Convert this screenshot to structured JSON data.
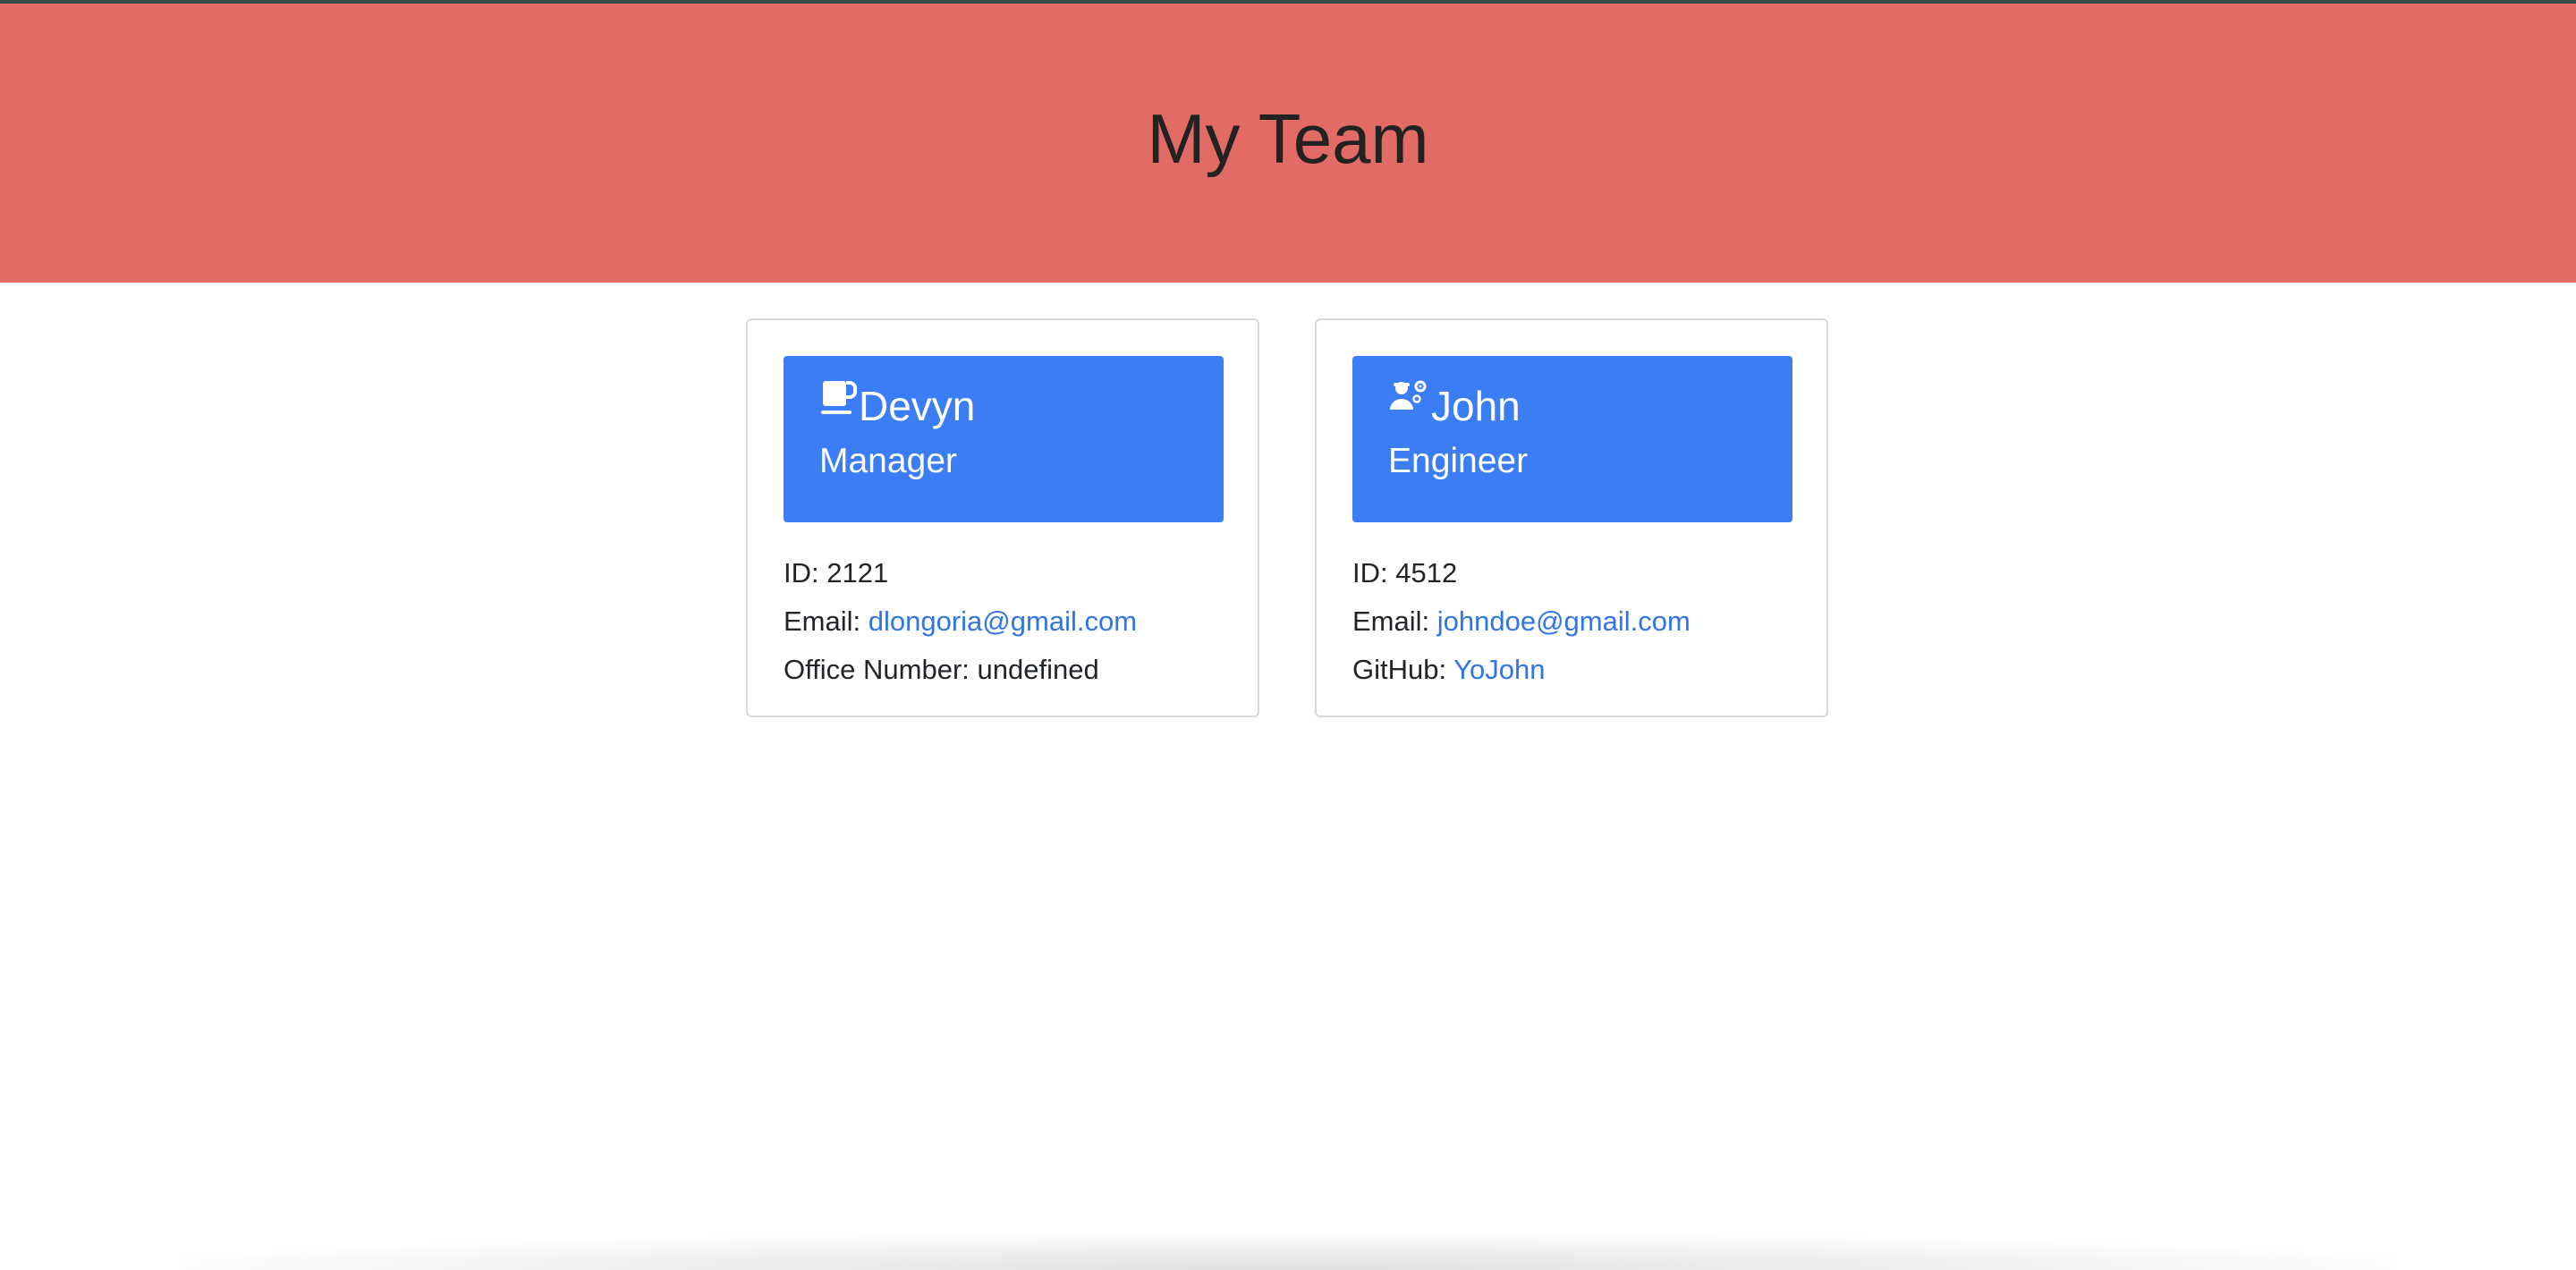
{
  "header": {
    "title": "My Team"
  },
  "employees": [
    {
      "icon": "coffee-icon",
      "name": "Devyn",
      "role": "Manager",
      "id_label": "ID: ",
      "id": "2121",
      "email_label": "Email: ",
      "email": "dlongoria@gmail.com",
      "extra_label": "Office Number: ",
      "extra_value": "undefined"
    },
    {
      "icon": "engineer-icon",
      "name": "John",
      "role": "Engineer",
      "id_label": "ID: ",
      "id": "4512",
      "email_label": "Email: ",
      "email": "johndoe@gmail.com",
      "extra_label": "GitHub: ",
      "extra_value": "YoJohn"
    }
  ],
  "colors": {
    "header_bg": "#e26b66",
    "card_head_bg": "#3a7df5",
    "link": "#2f74e8"
  }
}
